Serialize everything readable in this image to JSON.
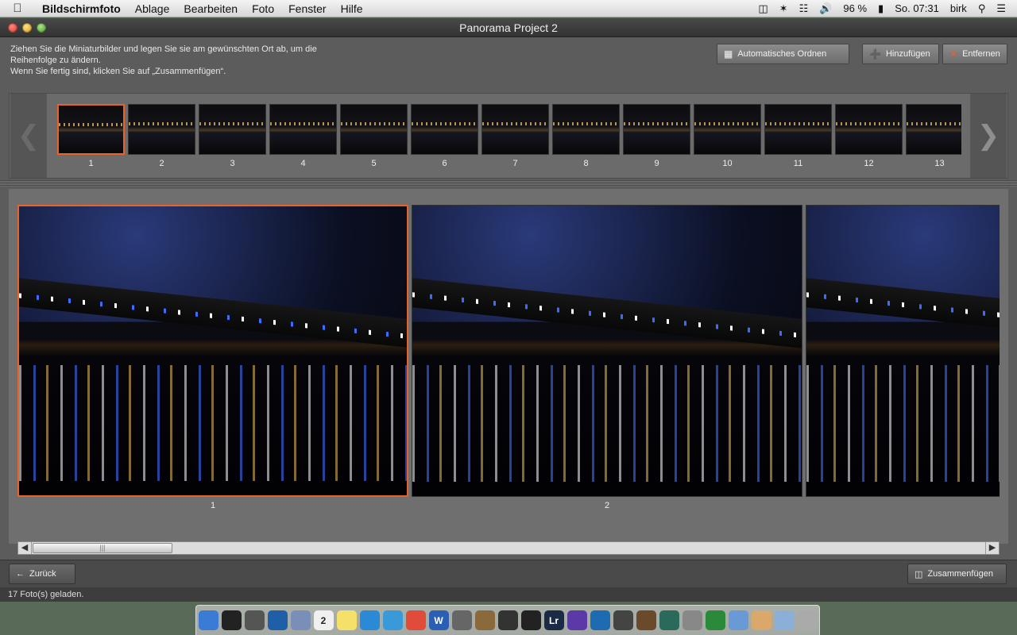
{
  "menubar": {
    "apple": "",
    "app": "Bildschirmfoto",
    "items": [
      "Ablage",
      "Bearbeiten",
      "Foto",
      "Fenster",
      "Hilfe"
    ],
    "battery": "96 %",
    "clock": "So. 07:31",
    "user": "birk"
  },
  "window": {
    "title": "Panorama Project 2"
  },
  "instructions": {
    "line1": "Ziehen Sie die Miniaturbilder und legen Sie sie am gewünschten Ort ab, um die Reihenfolge zu ändern.",
    "line2": "Wenn Sie fertig sind, klicken Sie auf „Zusammenfügen“."
  },
  "toolbar": {
    "auto_label": "Automatisches Ordnen",
    "add_label": "Hinzufügen",
    "remove_label": "Entfernen"
  },
  "thumbnails": [
    "1",
    "2",
    "3",
    "4",
    "5",
    "6",
    "7",
    "8",
    "9",
    "10",
    "11",
    "12",
    "13"
  ],
  "selected_thumbnail": "1",
  "preview": {
    "photos": [
      "1",
      "2"
    ]
  },
  "bottom": {
    "back_label": "Zurück",
    "merge_label": "Zusammenfügen"
  },
  "status": "17 Foto(s) geladen.",
  "dock": {
    "icons": [
      "finder-icon",
      "terminal-icon",
      "app-icon",
      "safari-icon",
      "preview-icon",
      "calendar-icon",
      "notes-icon",
      "itunes-icon",
      "compass-icon",
      "chrome-icon",
      "word-icon",
      "camera-icon",
      "photos-icon",
      "aperture-icon",
      "nikon-icon",
      "lightroom-icon",
      "app2-icon",
      "app3-icon",
      "app4-icon",
      "app5-icon",
      "app6-icon",
      "app7-icon",
      "app8-icon",
      "folder-icon",
      "home-icon",
      "downloads-icon",
      "trash-icon"
    ],
    "calendar_day": "2",
    "lightroom_text": "Lr",
    "word_text": "W"
  },
  "colors": {
    "accent": "#e8622a"
  }
}
